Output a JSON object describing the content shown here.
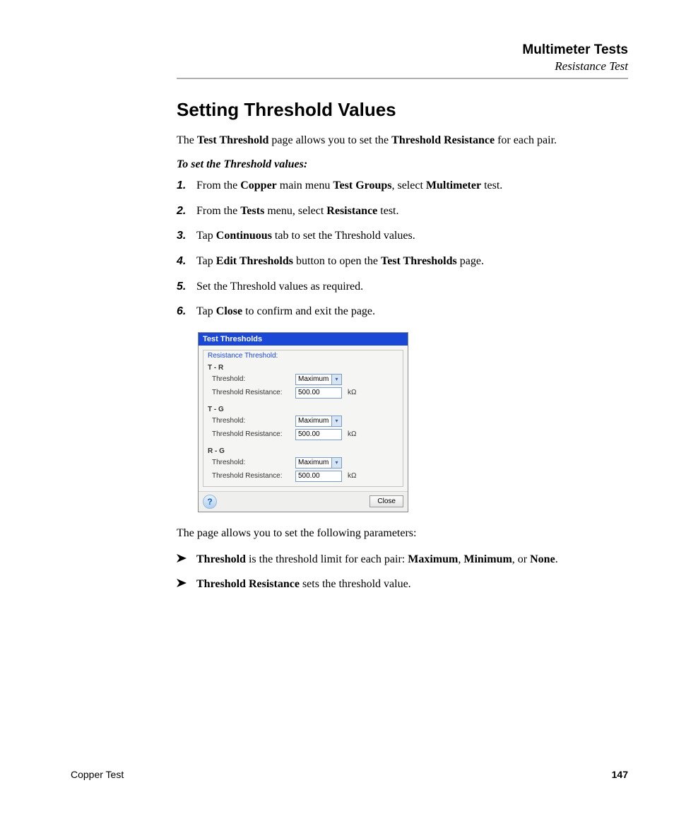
{
  "header": {
    "chapter": "Multimeter Tests",
    "section": "Resistance Test"
  },
  "heading": "Setting Threshold Values",
  "intro_parts": {
    "t1": "The ",
    "b1": "Test Threshold",
    "t2": " page allows you to set the ",
    "b2": "Threshold Resistance",
    "t3": " for each pair."
  },
  "sub_heading": "To set the Threshold values:",
  "steps": [
    {
      "num": "1.",
      "parts": {
        "t1": "From the ",
        "b1": "Copper",
        "t2": " main menu ",
        "b2": "Test Groups",
        "t3": ", select ",
        "b3": "Multimeter",
        "t4": " test."
      }
    },
    {
      "num": "2.",
      "parts": {
        "t1": "From the ",
        "b1": "Tests",
        "t2": " menu, select ",
        "b2": "Resistance",
        "t3": " test."
      }
    },
    {
      "num": "3.",
      "parts": {
        "t1": "Tap ",
        "b1": "Continuous",
        "t2": " tab to set the Threshold values."
      }
    },
    {
      "num": "4.",
      "parts": {
        "t1": "Tap ",
        "b1": "Edit Thresholds",
        "t2": " button to open the ",
        "b2": "Test Thresholds",
        "t3": " page."
      }
    },
    {
      "num": "5.",
      "parts": {
        "t1": "Set the Threshold values as required."
      }
    },
    {
      "num": "6.",
      "parts": {
        "t1": "Tap ",
        "b1": "Close",
        "t2": " to confirm and exit the page."
      }
    }
  ],
  "dialog": {
    "title": "Test Thresholds",
    "fieldset_title": "Resistance Threshold:",
    "groups": [
      {
        "name": "T - R",
        "threshold_label": "Threshold:",
        "threshold_value": "Maximum",
        "resistance_label": "Threshold Resistance:",
        "resistance_value": "500.00",
        "unit": "kΩ"
      },
      {
        "name": "T - G",
        "threshold_label": "Threshold:",
        "threshold_value": "Maximum",
        "resistance_label": "Threshold Resistance:",
        "resistance_value": "500.00",
        "unit": "kΩ"
      },
      {
        "name": "R - G",
        "threshold_label": "Threshold:",
        "threshold_value": "Maximum",
        "resistance_label": "Threshold Resistance:",
        "resistance_value": "500.00",
        "unit": "kΩ"
      }
    ],
    "close_label": "Close",
    "help_char": "?"
  },
  "desc": "The page allows you to set the following parameters:",
  "bullets": [
    {
      "parts": {
        "b1": "Threshold",
        "t1": " is the threshold limit for each pair: ",
        "b2": "Maximum",
        "t2": ", ",
        "b3": "Minimum",
        "t3": ", or ",
        "b4": "None",
        "t4": "."
      }
    },
    {
      "parts": {
        "b1": "Threshold Resistance",
        "t1": " sets the threshold value."
      }
    }
  ],
  "footer": {
    "left": "Copper Test",
    "page": "147"
  }
}
